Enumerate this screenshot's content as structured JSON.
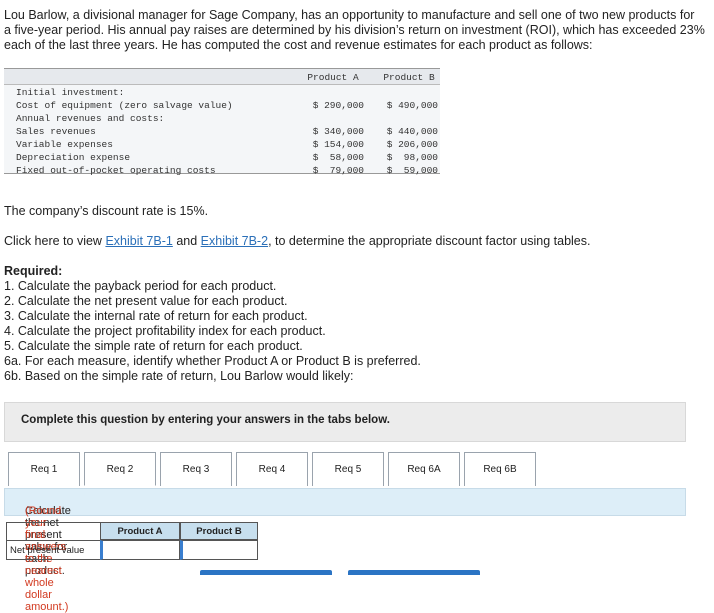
{
  "intro": {
    "line1": "Lou Barlow, a divisional manager for Sage Company, has an opportunity to manufacture and sell one of two new products for",
    "line2": "a five-year period. His annual pay raises are determined by his division’s return on investment (ROI), which has exceeded 23%",
    "line3": "each of the last three years. He has computed the cost and revenue estimates for each product as follows:"
  },
  "cost_table": {
    "col_a": "Product A",
    "col_b": "Product B",
    "rows": [
      {
        "label": "Initial investment:",
        "a": "",
        "b": ""
      },
      {
        "label": "Cost of equipment (zero salvage value)",
        "a": "$ 290,000",
        "b": "$ 490,000"
      },
      {
        "label": "Annual revenues and costs:",
        "a": "",
        "b": ""
      },
      {
        "label": "Sales revenues",
        "a": "$ 340,000",
        "b": "$ 440,000"
      },
      {
        "label": "Variable expenses",
        "a": "$ 154,000",
        "b": "$ 206,000"
      },
      {
        "label": "Depreciation expense",
        "a": "$  58,000",
        "b": "$  98,000"
      },
      {
        "label": "Fixed out-of-pocket operating costs",
        "a": "$  79,000",
        "b": "$  59,000"
      }
    ]
  },
  "discount_rate": "The company’s discount rate is 15%.",
  "click_line": {
    "pre": "Click here to view ",
    "link1": "Exhibit 7B-1",
    "mid": " and ",
    "link2": "Exhibit 7B-2",
    "post": ", to determine the appropriate discount factor using tables."
  },
  "required": {
    "title": "Required:",
    "items": [
      "1. Calculate the payback period for each product.",
      "2. Calculate the net present value for each product.",
      "3. Calculate the internal rate of return for each product.",
      "4. Calculate the project profitability index for each product.",
      "5. Calculate the simple rate of return for each product.",
      "6a. For each measure, identify whether Product A or Product B is preferred.",
      "6b. Based on the simple rate of return, Lou Barlow would likely:"
    ]
  },
  "complete_text": "Complete this question by entering your answers in the tabs below.",
  "tabs": [
    "Req 1",
    "Req 2",
    "Req 3",
    "Req 4",
    "Req 5",
    "Req 6A",
    "Req 6B"
  ],
  "active_tab": "Req 2",
  "instruction": {
    "text": "Calculate the net present value for each product.",
    "round": "(Round your final answers to the nearest whole dollar amount.)"
  },
  "answer_table": {
    "col_a": "Product A",
    "col_b": "Product B",
    "row_label": "Net present value",
    "value_a": "",
    "value_b": ""
  }
}
